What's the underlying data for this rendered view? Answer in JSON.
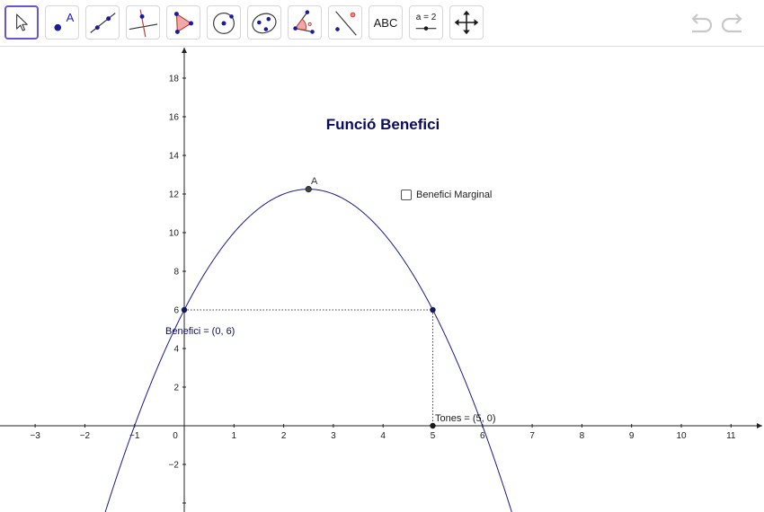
{
  "toolbar": {
    "tools": [
      {
        "name": "move-tool",
        "icon": "arrow-cursor-icon",
        "active": true
      },
      {
        "name": "point-tool",
        "icon": "point-icon",
        "label": "A"
      },
      {
        "name": "line-tool",
        "icon": "line-icon"
      },
      {
        "name": "perpendicular-line-tool",
        "icon": "perpendicular-line-icon"
      },
      {
        "name": "polygon-tool",
        "icon": "polygon-icon"
      },
      {
        "name": "circle-tool",
        "icon": "circle-center-icon"
      },
      {
        "name": "conic-tool",
        "icon": "ellipse-icon"
      },
      {
        "name": "angle-tool",
        "icon": "angle-icon"
      },
      {
        "name": "reflect-tool",
        "icon": "reflect-point-icon"
      },
      {
        "name": "text-tool",
        "icon": "text-icon",
        "label": "ABC"
      },
      {
        "name": "slider-tool",
        "icon": "slider-icon",
        "label": "a = 2"
      },
      {
        "name": "move-view-tool",
        "icon": "move-graphics-view-icon"
      }
    ],
    "undo_icon": "undo-icon",
    "redo_icon": "redo-icon"
  },
  "graph": {
    "title": "Funció Benefici",
    "title_color": "#0b0b5e",
    "curve_color": "#1a1a8c",
    "function_coeffs": [
      -1,
      5,
      6
    ],
    "x_ticks": [
      "−3",
      "−2",
      "−1",
      "0",
      "1",
      "2",
      "3",
      "4",
      "5",
      "6",
      "7",
      "8",
      "9",
      "10",
      "11"
    ],
    "y_ticks": [
      "18",
      "16",
      "14",
      "12",
      "10",
      "8",
      "6",
      "4",
      "2",
      "−2"
    ],
    "point_a": {
      "label": "A",
      "x": 2.5,
      "y": 12.25
    },
    "point_benefici": {
      "label": "Benefici = (0, 6)",
      "x": 0,
      "y": 6
    },
    "point_tones": {
      "label": "Tones = (5, 0)",
      "x": 5,
      "y": 0
    },
    "point_mid": {
      "x": 5,
      "y": 6
    },
    "checkbox": {
      "label": "Benefici Marginal",
      "checked": false
    }
  }
}
